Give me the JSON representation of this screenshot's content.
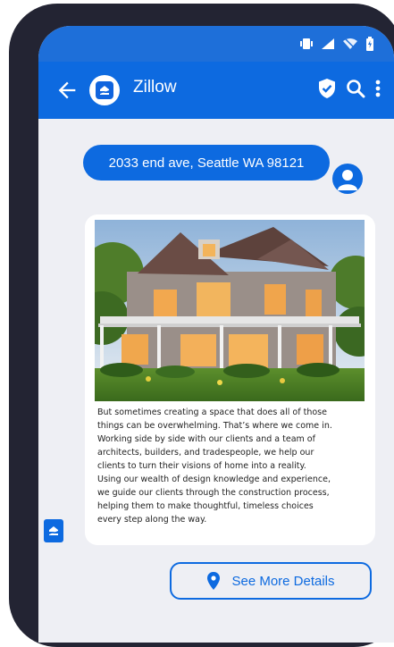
{
  "header": {
    "title": "Zillow"
  },
  "icons": {
    "back": "back-arrow-icon",
    "brand": "zillow-logo-icon",
    "shield": "shield-check-icon",
    "search": "search-icon",
    "menu": "more-vert-icon",
    "user": "user-avatar-icon",
    "pin": "location-pin-icon"
  },
  "chat": {
    "user_message": "2033 end ave, Seattle WA 98121",
    "bot_card": {
      "paragraph_lines": [
        "But sometimes creating a space that does all of those",
        "things can be overwhelming. That’s where we come in.",
        "Working side by side with our clients and a team of",
        "architects, builders, and tradespeople, we help our",
        "clients to turn their visions of home into a reality.",
        "Using our wealth of design knowledge and experience,",
        "we guide our clients through the construction process,",
        "helping them to make thoughtful, timeless choices",
        "every step along the way."
      ]
    },
    "details_button_label": "See More Details"
  },
  "colors": {
    "primary": "#0d6ae0",
    "status_bar": "#1e6fd9",
    "background": "#eeeff4",
    "phone_frame": "#232433"
  }
}
